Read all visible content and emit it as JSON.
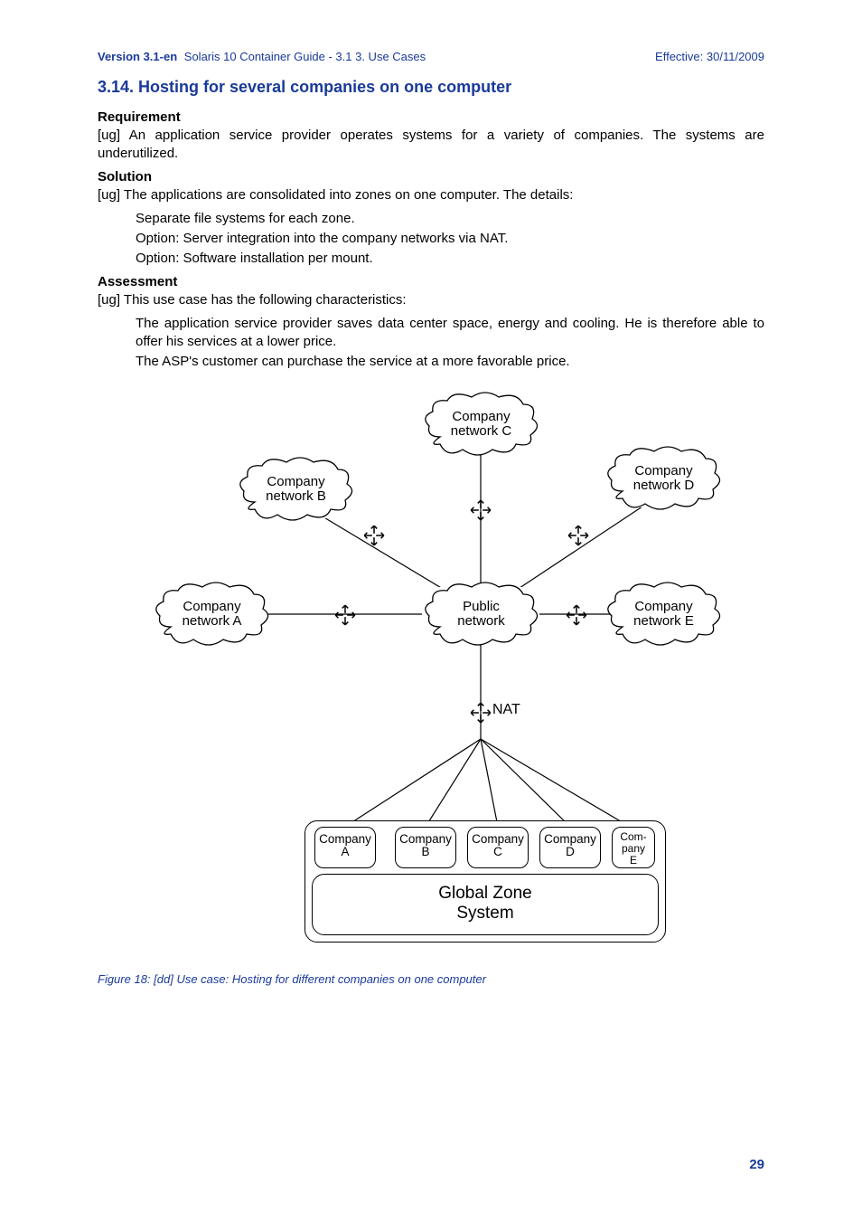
{
  "header": {
    "version": "Version 3.1-en",
    "doc_title": "Solaris 10 Container Guide - 3.1   3. Use Cases",
    "effective": "Effective: 30/11/2009"
  },
  "section": {
    "heading": "3.14. Hosting for several companies on one computer",
    "requirement_label": "Requirement",
    "requirement_text": "[ug] An application service provider operates systems for a variety of companies. The systems are underutilized.",
    "solution_label": "Solution",
    "solution_text": "[ug] The applications are consolidated into zones on one computer. The details:",
    "solution_bullets": [
      "Separate file systems for each zone.",
      "Option: Server integration into the company networks via NAT.",
      "Option: Software installation per mount."
    ],
    "assessment_label": "Assessment",
    "assessment_text": "[ug] This use case has the following characteristics:",
    "assessment_bullets": [
      "The application service provider saves data center space, energy and cooling. He is therefore able to offer his services at a lower price.",
      "The ASP's customer can purchase the service at a more favorable price."
    ]
  },
  "figure": {
    "caption": "Figure 18: [dd] Use case: Hosting for different companies on one computer",
    "clouds": {
      "a": "Company\nnetwork A",
      "b": "Company\nnetwork B",
      "c": "Company\nnetwork C",
      "d": "Company\nnetwork D",
      "e": "Company\nnetwork E",
      "public": "Public\nnetwork"
    },
    "nat_label": "NAT",
    "zones": {
      "a": "Company\nA",
      "b": "Company\nB",
      "c": "Company\nC",
      "d": "Company\nD",
      "e": "Com-\npany\nE"
    },
    "global_zone": "Global Zone\nSystem"
  },
  "page_number": "29"
}
